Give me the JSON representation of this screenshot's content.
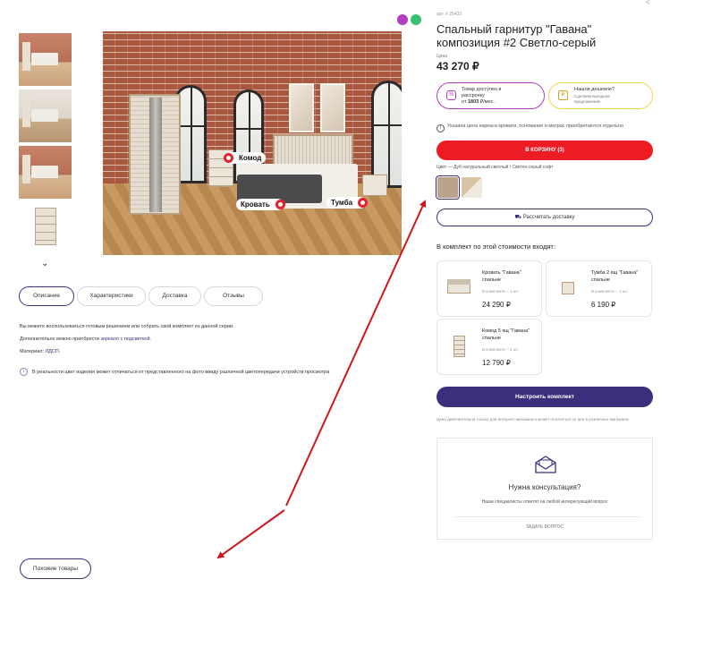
{
  "gallery": {
    "hotspots": {
      "komod": "Комод",
      "krovat": "Кровать",
      "tumba": "Тумба"
    }
  },
  "tabs": [
    "Описание",
    "Характеристики",
    "Доставка",
    "Отзывы"
  ],
  "description": {
    "line1": "Вы можете воспользоваться готовым решением или собрать свой комплект из данной серии.",
    "line2_prefix": "Дополнительно можно приобрести ",
    "line2_link": "зеркало с подсветкой",
    "line2_suffix": ".",
    "material_label": "Материал: ",
    "material_value": "ЛДСП",
    "material_suffix": ".",
    "disclaimer": "В реальности цвет изделия может отличаться от представленного на фото ввиду различной цветопередачи устройств просмотра"
  },
  "product": {
    "sku": "арт. # 25432",
    "title": "Спальный гарнитур \"Гавана\" композиция #2 Светло-серый",
    "price_label": "Цена",
    "price": "43 270 ₽",
    "installment": {
      "line1": "Товар доступен в",
      "line2": "рассрочку",
      "line3_prefix": "от ",
      "line3_value": "1803",
      "line3_suffix": " ₽/мес."
    },
    "cheaper": {
      "line1": "Нашли дешевле?",
      "line2": "Сделаем выгодное",
      "line3": "предложение!"
    },
    "note": "Указана цена каркаса кровати, основание и матрас приобретаются отдельно",
    "cart_button": "В КОРЗИНУ (3)",
    "color_label": "Цвет —",
    "color_value": "Дуб натуральный светлый / Светло-серый софт",
    "colors": [
      "#b9a48b",
      "#d8c3a5"
    ],
    "delivery_button": "Рассчитать доставку"
  },
  "set": {
    "heading": "В комплект по этой стоимости входят:",
    "items": [
      {
        "name": "Кровать \"Гавана\" спальне",
        "qty": "В комплекте – 1 шт.",
        "price": "24 290 ₽"
      },
      {
        "name": "Тумба 2 ящ \"Гавана\" спальне",
        "qty": "В комплекте – 1 шт.",
        "price": "6 190 ₽"
      },
      {
        "name": "Комод 5 ящ \"Гавана\" спальне",
        "qty": "В комплекте – 1 шт.",
        "price": "12 790 ₽"
      }
    ],
    "configure_button": "Настроить комплект",
    "disclaimer": "Цена действительна только для интернет-магазина и может отличаться от цен в розничных магазинах"
  },
  "consult": {
    "title": "Нужна консультация?",
    "subtitle": "Наши специалисты ответят на любой интересующий вопрос",
    "action": "ЗАДАТЬ ВОПРОС"
  },
  "similar_button": "Похожие товары",
  "colors": {
    "accent": "#3b2f7c",
    "cart": "#ed1c24",
    "promo_purple": "#b33fbf",
    "promo_yellow": "#f2d54a",
    "annotation": "#d0161d"
  }
}
